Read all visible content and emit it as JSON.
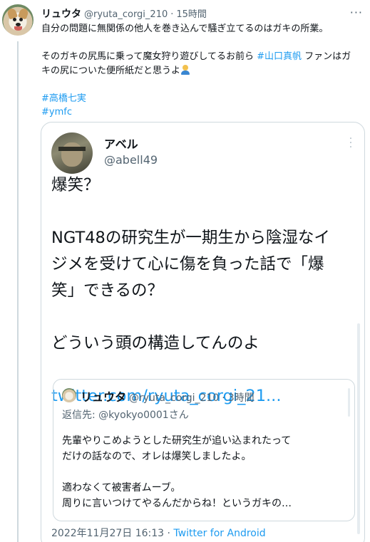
{
  "tweet": {
    "display_name": "リュウタ",
    "handle": "@ryuta_corgi_210",
    "dot": "·",
    "time": "15時間",
    "more": "···",
    "line1": "自分の問題に無関係の他人を巻き込んで騒ぎ立てるのはガキの所業。",
    "line2a": "そのガキの尻馬に乗って魔女狩り遊びしてるお前ら ",
    "line2_tag": "#山口真帆",
    "line2b": " ファンはガ",
    "line3": "キの尻についた便所紙だと思うよ",
    "tag1": "#高橋七実",
    "tag2": "#ymfc",
    "emoji_name": "person-shrugging-emoji"
  },
  "quote": {
    "display_name": "アベル",
    "handle": "@abell49",
    "lines": [
      "爆笑？",
      "",
      "NGT48の研究生が一期生から陰湿なイ",
      "ジメを受けて心に傷を負った話で「爆",
      "笑」できるの？",
      "",
      "どういう頭の構造してんのよ",
      ""
    ],
    "link": "twitter.com/ryuta_corgi_21...",
    "footer_date": "2022年11月27日 16:13",
    "footer_dot": " · ",
    "footer_app": "Twitter for Android"
  },
  "inner_quote": {
    "display_name": "リュウタ",
    "handle": "@ryuta_corgi_210",
    "dot": "·",
    "time": "3時間",
    "reply_prefix": "返信先: ",
    "reply_mention": "@kyokyo0001さん",
    "line1": "先輩やりこめようとした研究生が追い込まれたって",
    "line2": "だけの話なので、オレは爆笑しましたよ。",
    "line3": "適わなくて被害者ムーブ。",
    "line4": "周りに言いつけてやるんだからね！というガキの…"
  },
  "colors": {
    "link": "#1d9bf0",
    "secondary_text": "#536471",
    "border": "#cfd9de"
  }
}
